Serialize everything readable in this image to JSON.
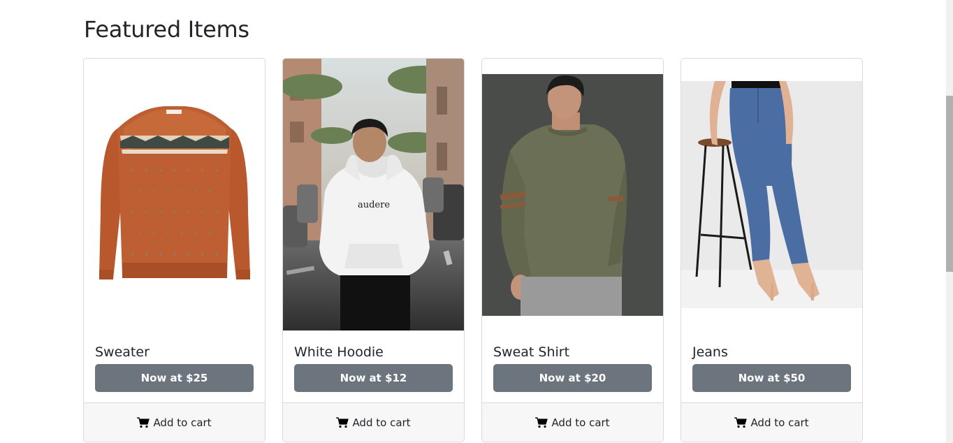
{
  "page": {
    "heading": "Featured Items"
  },
  "cards": [
    {
      "title": "Sweater",
      "price_label": "Now at $25",
      "cart_label": "Add to cart",
      "image": "orange-fair-isle-sweater"
    },
    {
      "title": "White Hoodie",
      "price_label": "Now at $12",
      "cart_label": "Add to cart",
      "image": "man-in-white-hoodie-street"
    },
    {
      "title": "Sweat Shirt",
      "price_label": "Now at $20",
      "cart_label": "Add to cart",
      "image": "man-in-olive-sweatshirt"
    },
    {
      "title": "Jeans",
      "price_label": "Now at $50",
      "cart_label": "Add to cart",
      "image": "woman-in-blue-jeans-on-stool"
    }
  ],
  "hoodie_print": "audere",
  "colors": {
    "button": "#6c757d",
    "footer": "#f7f7f8",
    "border": "#d8dadc"
  }
}
